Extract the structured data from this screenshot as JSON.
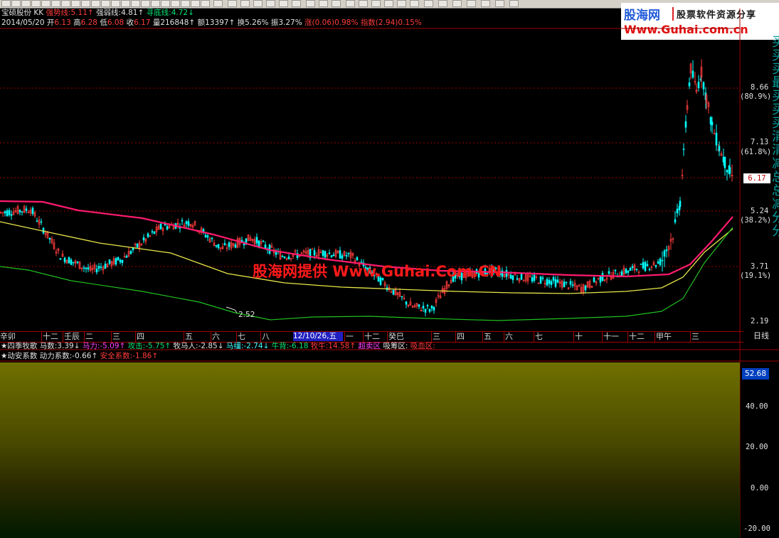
{
  "header": {
    "stock_name": "宝硕股份",
    "kk": "KK",
    "strong_label": "强势线:",
    "strong_val": "5.11",
    "weak_label": "强弱线:",
    "weak_val": "4.81",
    "bottom_label": "寻底线:",
    "bottom_val": "4.72",
    "date": "2014/05/20",
    "open_label": "开",
    "open": "6.13",
    "high_label": "高",
    "high": "6.28",
    "low_label": "低",
    "low": "6.08",
    "close_label": "收",
    "close": "6.17",
    "vol_label": "量",
    "vol": "216848",
    "amt_label": "额",
    "amt": "13397",
    "turn_label": "换",
    "turn": "5.26%",
    "amp_label": "振",
    "amp": "3.27%",
    "chg": "涨(0.06)0.98%",
    "index": "指数(2.94)0.15%"
  },
  "logo": {
    "name": "股海网",
    "slogan": "股票软件资源分享",
    "url": "Www.Guhai.com.cn"
  },
  "price_axis": {
    "ticks": [
      {
        "value": "8.66",
        "pct": "(80.9%)"
      },
      {
        "value": "7.13",
        "pct": "(61.8%)"
      },
      {
        "value": "5.24",
        "pct": "(38.2%)"
      },
      {
        "value": "3.71",
        "pct": "(19.1%)"
      },
      {
        "value": "2.19",
        "pct": ""
      }
    ],
    "current": "6.17",
    "low_marker": "2.52"
  },
  "watermark": "股海网提供 Www.Guhai.Com.CN",
  "time_axis": {
    "labels": [
      "辛卯",
      "十二",
      "壬辰",
      "二",
      "三",
      "四",
      "五",
      "六",
      "七",
      "八",
      "一",
      "十二",
      "癸巳",
      "三",
      "四",
      "五",
      "六",
      "七",
      "十",
      "十一",
      "十二",
      "甲午",
      "三"
    ],
    "cursor_date": "12/10/26,五",
    "period": "日线"
  },
  "indicator1": {
    "title": "★四季牧歌",
    "items": [
      {
        "label": "马数:3.39↓",
        "color": "#e0e0e0"
      },
      {
        "label": "马力:-5.09↑",
        "color": "#ff40ff"
      },
      {
        "label": "攻击:-5.75↑",
        "color": "#00e676"
      },
      {
        "label": "牧马人:-2.85↓",
        "color": "#e0e0e0"
      },
      {
        "label": "马缰:-2.74↓",
        "color": "#40ffff"
      },
      {
        "label": "牛背:-6.18",
        "color": "#00e676"
      },
      {
        "label": "牧牛:14.58↑",
        "color": "#ff3c3c"
      },
      {
        "label": "超卖区",
        "color": "#ff40ff"
      },
      {
        "label": "吸筹区:",
        "color": "#e0e0e0"
      },
      {
        "label": "吸血区:",
        "color": "#ff3c3c"
      }
    ]
  },
  "indicator2": {
    "title": "★动安系数",
    "power_label": "动力系数:-0.66↑",
    "safe_label": "安全系数:-1.86↑"
  },
  "sub_axis": {
    "max_box": "52.68",
    "ticks": [
      "40.00",
      "20.00",
      "0.00",
      "-20.00"
    ]
  },
  "colors": {
    "up": "#ff3c3c",
    "down": "#00ffff",
    "ma_pink": "#ff1a6e",
    "ma_yellow": "#e8e84a",
    "ma_green": "#20c020",
    "sub_magenta": "#ff40ff",
    "sub_red": "#ff2020",
    "sub_cyan": "#40ffff",
    "sub_green": "#40ff40"
  },
  "side_chars": [
    "买",
    "买",
    "买",
    "最",
    "买",
    "买",
    "买",
    "清",
    "清",
    "减",
    "总",
    "总",
    "减",
    "分",
    "分"
  ]
}
